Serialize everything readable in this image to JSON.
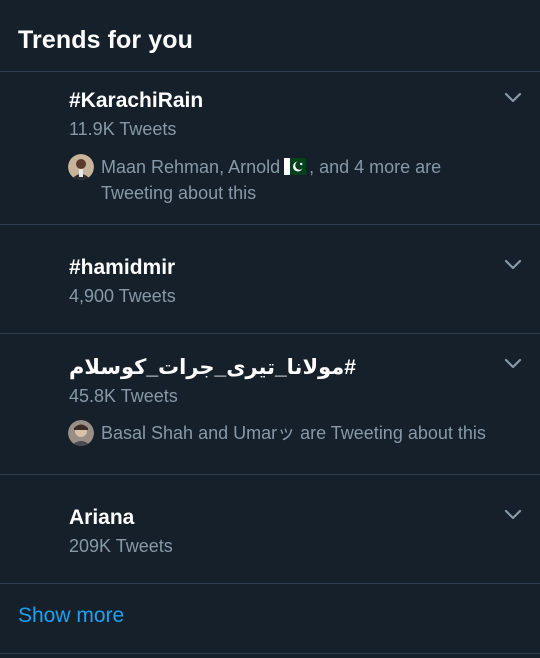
{
  "header": {
    "title": "Trends for you"
  },
  "trends": [
    {
      "name": "#KarachiRain",
      "count": "11.9K Tweets",
      "social_text_before_flag": "Maan Rehman, Arnold",
      "social_text_after_flag": ", and 4 more are Tweeting about this",
      "icon": "chevron-down-icon"
    },
    {
      "name": "#hamidmir",
      "count": "4,900 Tweets",
      "icon": "chevron-down-icon"
    },
    {
      "name": "#مولانا_تیری_جرات_کوسلام",
      "count": "45.8K Tweets",
      "social_text": "Basal Shah and Umarッ are Tweeting about this",
      "icon": "chevron-down-icon"
    },
    {
      "name": "Ariana",
      "count": "209K Tweets",
      "icon": "chevron-down-icon"
    }
  ],
  "show_more": {
    "label": "Show more"
  },
  "colors": {
    "background": "#15202b",
    "divider": "#2f3e4e",
    "secondary_text": "#8899a6",
    "link": "#1da1f2"
  }
}
